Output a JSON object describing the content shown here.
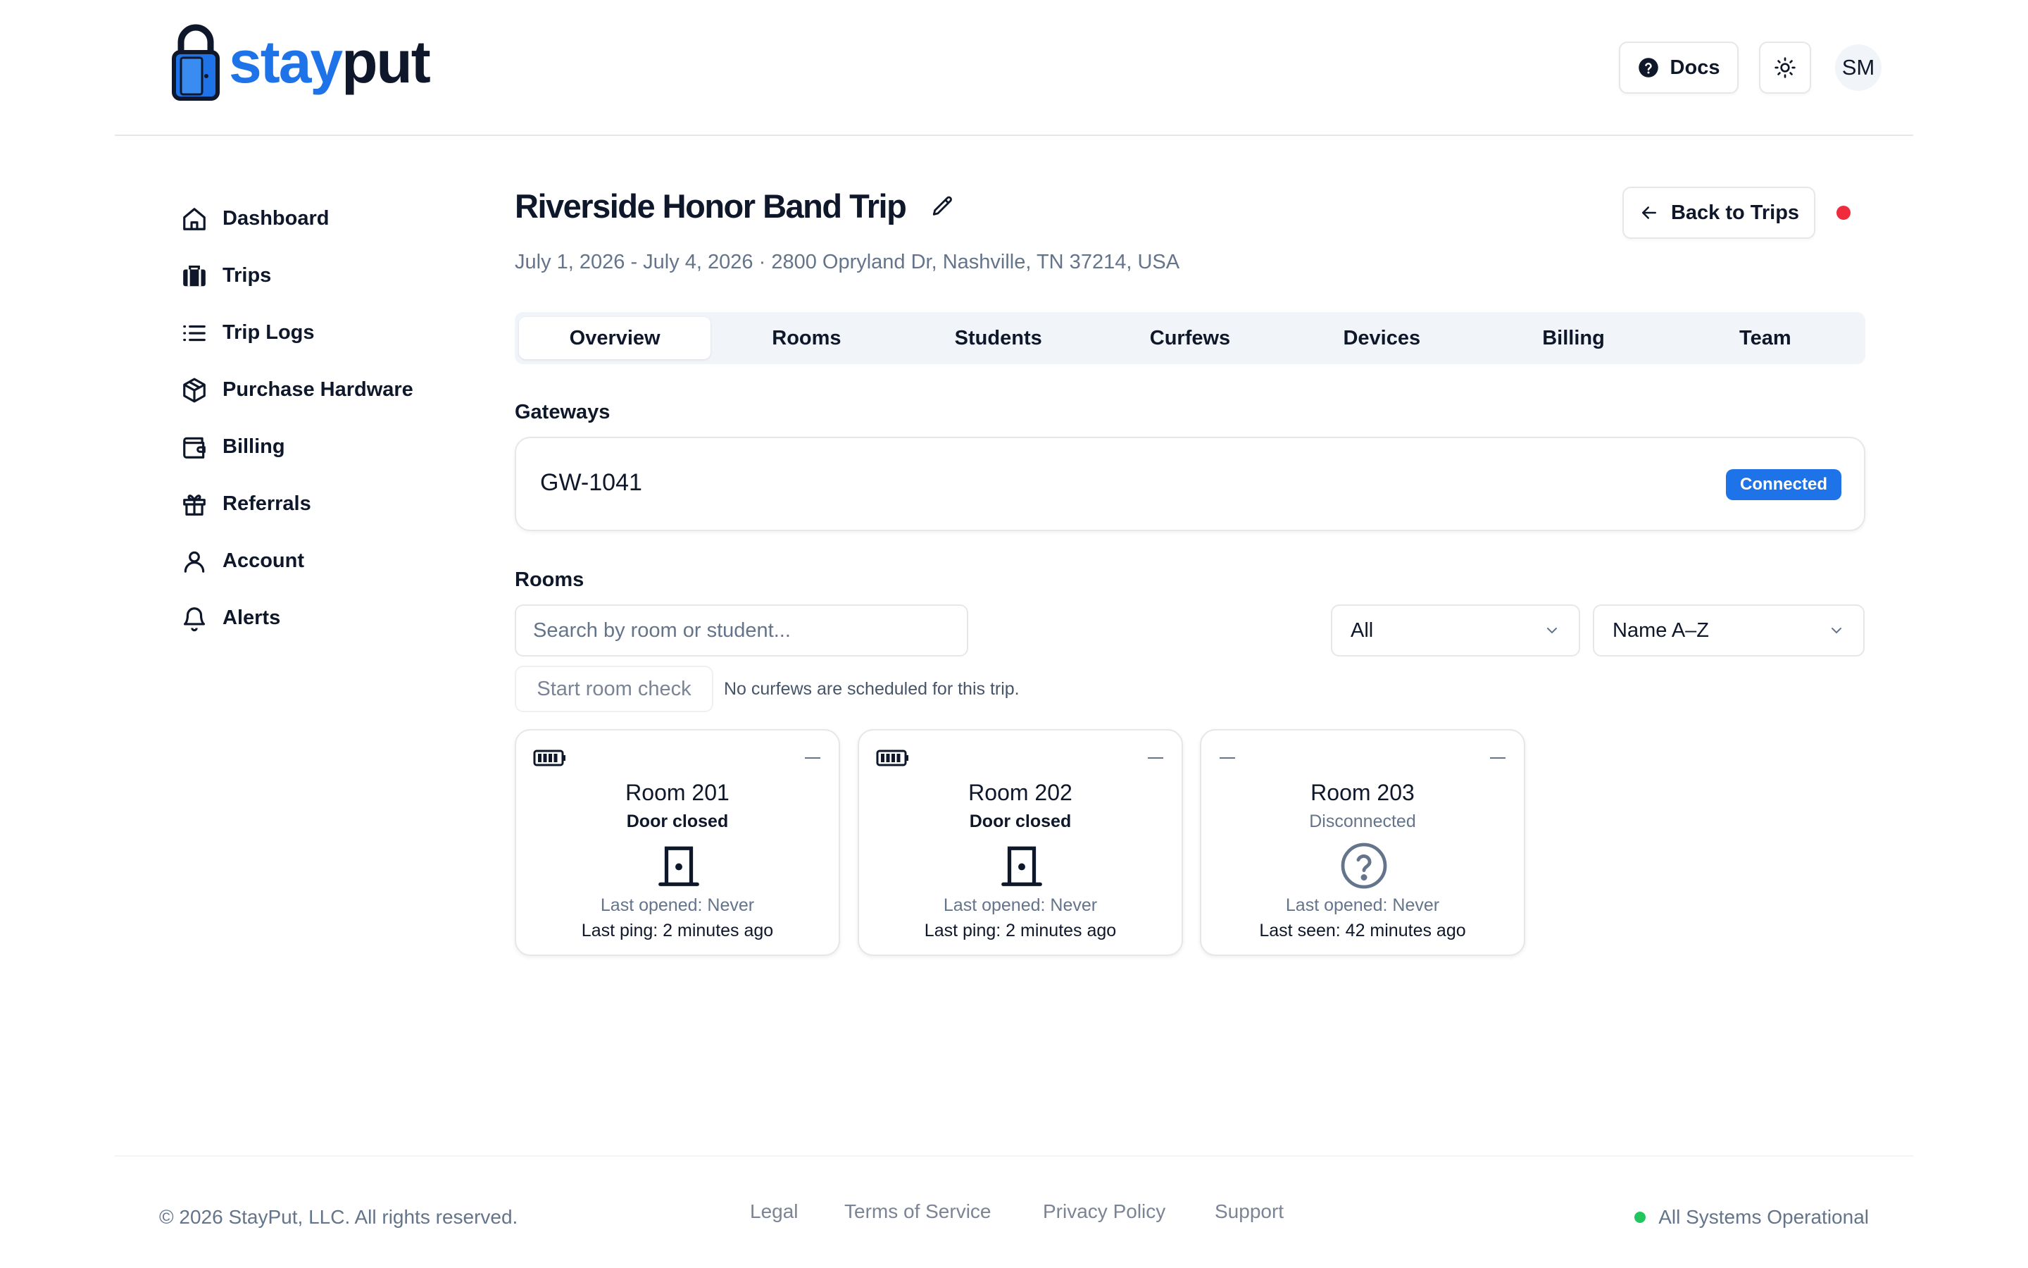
{
  "brand": {
    "part1": "stay",
    "part2": "put",
    "accent": "#1e73e8"
  },
  "header": {
    "docs_label": "Docs",
    "avatar_initials": "SM"
  },
  "sidebar": {
    "items": [
      {
        "label": "Dashboard",
        "icon": "home-icon"
      },
      {
        "label": "Trips",
        "icon": "luggage-icon"
      },
      {
        "label": "Trip Logs",
        "icon": "list-icon"
      },
      {
        "label": "Purchase Hardware",
        "icon": "package-icon"
      },
      {
        "label": "Billing",
        "icon": "wallet-icon"
      },
      {
        "label": "Referrals",
        "icon": "gift-icon"
      },
      {
        "label": "Account",
        "icon": "user-icon"
      },
      {
        "label": "Alerts",
        "icon": "bell-icon"
      }
    ]
  },
  "trip": {
    "title": "Riverside Honor Band Trip",
    "subtitle": "July 1, 2026 - July 4, 2026 · 2800 Opryland Dr, Nashville, TN 37214, USA",
    "back_label": "Back to Trips",
    "live_color": "#ef2b3c"
  },
  "tabs": [
    "Overview",
    "Rooms",
    "Students",
    "Curfews",
    "Devices",
    "Billing",
    "Team"
  ],
  "active_tab": "Overview",
  "gateways": {
    "label": "Gateways",
    "items": [
      {
        "name": "GW-1041",
        "status": "Connected"
      }
    ]
  },
  "rooms": {
    "label": "Rooms",
    "search_placeholder": "Search by room or student...",
    "filter_value": "All",
    "sort_value": "Name A–Z",
    "room_check_label": "Start room check",
    "curfew_note": "No curfews are scheduled for this trip.",
    "cards": [
      {
        "name": "Room 201",
        "status": "Door closed",
        "last_opened": "Last opened: Never",
        "last_contact": "Last ping: 2 minutes ago",
        "battery": "full-battery-icon"
      },
      {
        "name": "Room 202",
        "status": "Door closed",
        "last_opened": "Last opened: Never",
        "last_contact": "Last ping: 2 minutes ago",
        "battery": "full-battery-icon"
      },
      {
        "name": "Room 203",
        "status": "Disconnected",
        "last_opened": "Last opened: Never",
        "last_contact": "Last seen: 42 minutes ago",
        "battery": "none"
      }
    ]
  },
  "footer": {
    "copyright": "© 2026 StayPut, LLC. All rights reserved.",
    "links": [
      "Legal",
      "Terms of Service",
      "Privacy Policy",
      "Support"
    ],
    "status": "All Systems Operational"
  }
}
